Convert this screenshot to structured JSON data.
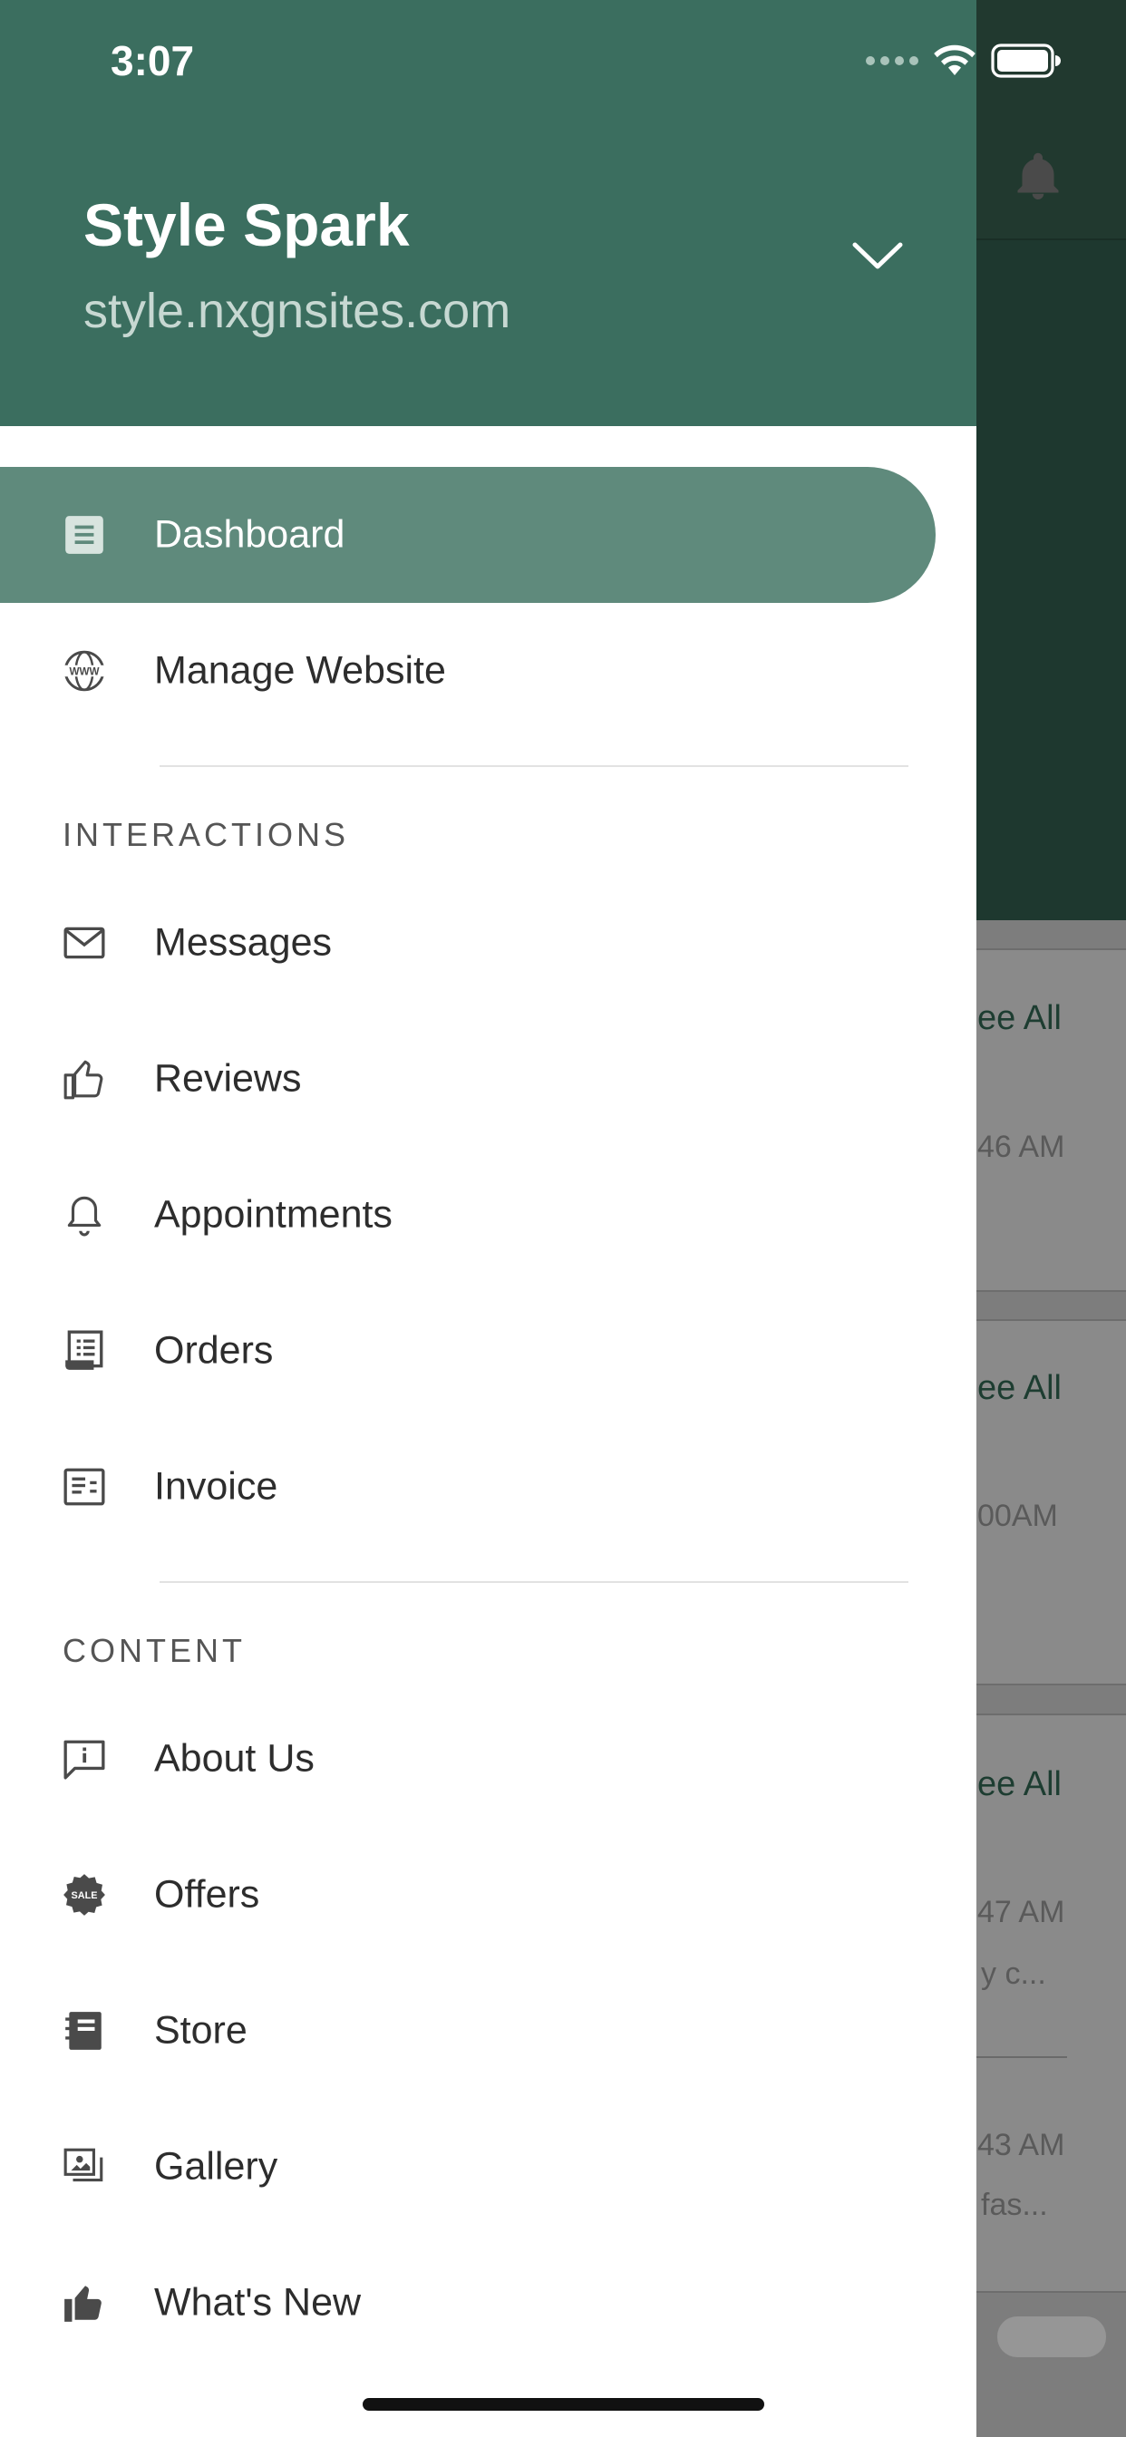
{
  "status_bar": {
    "time": "3:07"
  },
  "drawer": {
    "site_title": "Style Spark",
    "site_url": "style.nxgnsites.com"
  },
  "menu": {
    "dashboard": "Dashboard",
    "manage_website": "Manage Website",
    "interactions_title": "INTERACTIONS",
    "messages": "Messages",
    "reviews": "Reviews",
    "appointments": "Appointments",
    "orders": "Orders",
    "invoice": "Invoice",
    "content_title": "CONTENT",
    "about_us": "About Us",
    "offers": "Offers",
    "offers_icon_text": "SALE",
    "store": "Store",
    "gallery": "Gallery",
    "whats_new": "What's New"
  },
  "background": {
    "see_all": "ee All",
    "card1_time": "46 AM",
    "card2_time": "00AM",
    "card3_time": "47 AM",
    "card3_sub": "y c...",
    "card4_time": "43 AM",
    "card4_sub": "fas..."
  },
  "colors": {
    "drawer_header": "#3b6e5f",
    "active_pill": "#5f8a7c",
    "accent_dark": "#21392f"
  }
}
